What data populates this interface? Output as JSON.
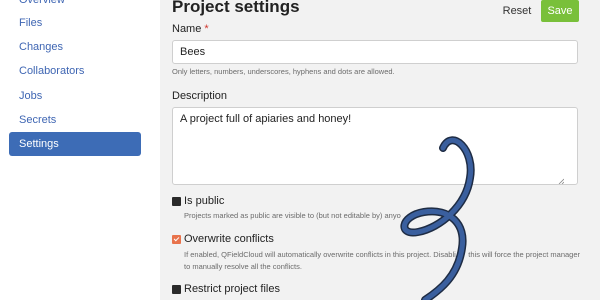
{
  "sidebar": {
    "items": [
      {
        "label": "Overview"
      },
      {
        "label": "Files"
      },
      {
        "label": "Changes"
      },
      {
        "label": "Collaborators"
      },
      {
        "label": "Jobs"
      },
      {
        "label": "Secrets"
      },
      {
        "label": "Settings",
        "active": true
      }
    ]
  },
  "header": {
    "title": "Project settings",
    "reset_label": "Reset",
    "save_label": "Save"
  },
  "form": {
    "name_label": "Name",
    "name_required_mark": "*",
    "name_value": "Bees",
    "name_help": "Only letters, numbers, underscores, hyphens and dots are allowed.",
    "description_label": "Description",
    "description_value": "A project full of apiaries and honey!",
    "is_public_label": "Is public",
    "is_public_checked": false,
    "is_public_help": "Projects marked as public are visible to (but not editable by) anyo",
    "overwrite_label": "Overwrite conflicts",
    "overwrite_checked": true,
    "overwrite_help": "If enabled, QFieldCloud will automatically overwrite conflicts in this project. Disabli      this will force the project manager to manually resolve all the conflicts.",
    "restrict_label": "Restrict project files",
    "restrict_checked": false
  },
  "colors": {
    "accent": "#3d6cb6",
    "link": "#3f66b3",
    "save": "#79c03a",
    "checkbox_on": "#e8734c",
    "required": "#d0352c",
    "scribble": "#3a5f9e"
  }
}
